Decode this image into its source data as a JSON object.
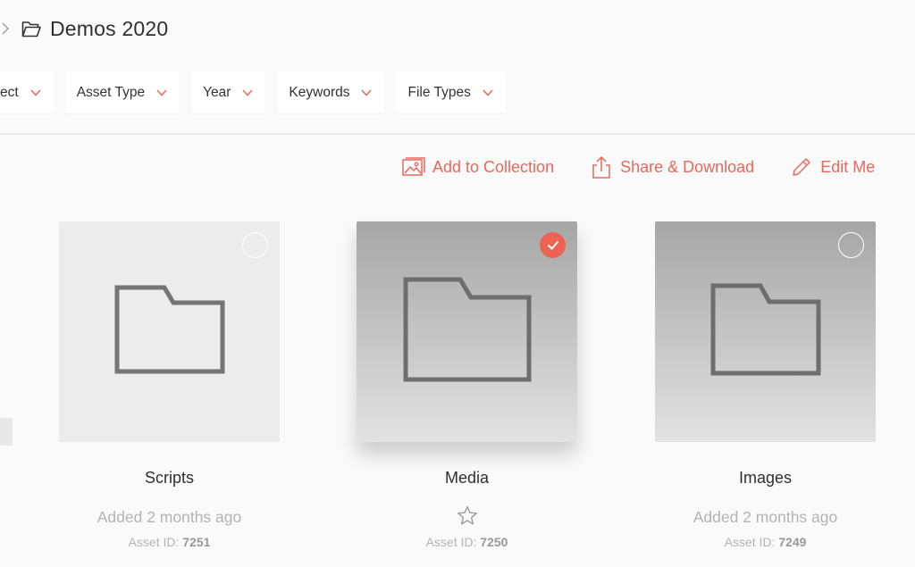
{
  "breadcrumb": {
    "title": "Demos 2020"
  },
  "filters": [
    {
      "label": "ect"
    },
    {
      "label": "Asset Type"
    },
    {
      "label": "Year"
    },
    {
      "label": "Keywords"
    },
    {
      "label": "File Types"
    }
  ],
  "actions": {
    "add_to_collection": "Add to Collection",
    "share_download": "Share & Download",
    "edit": "Edit Me"
  },
  "cards": [
    {
      "title": "Scripts",
      "meta": "Added 2 months ago",
      "asset_prefix": "Asset ID:",
      "asset_id": "7251",
      "selected": false
    },
    {
      "title": "Media",
      "meta": "",
      "asset_prefix": "Asset ID:",
      "asset_id": "7250",
      "selected": true
    },
    {
      "title": "Images",
      "meta": "Added 2 months ago",
      "asset_prefix": "Asset ID:",
      "asset_id": "7249",
      "selected": false
    }
  ],
  "colors": {
    "accent": "#e8685a",
    "check": "#ec6356"
  },
  "icons": {
    "breadcrumb": [
      "chevron-right-icon",
      "folder-open-icon"
    ],
    "filter_caret": "chevron-down-icon",
    "actions": [
      "image-icon",
      "share-icon",
      "pencil-icon"
    ],
    "card": "folder-icon",
    "favorite": "star-icon"
  }
}
